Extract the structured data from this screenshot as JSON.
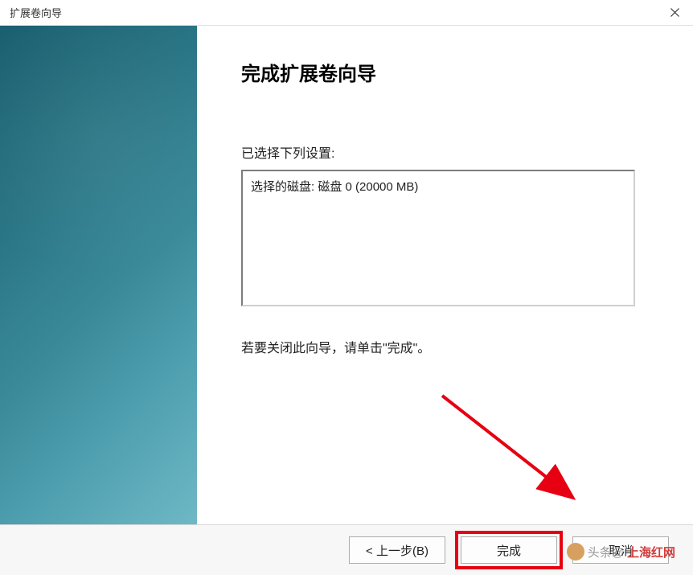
{
  "window": {
    "title": "扩展卷向导"
  },
  "wizard": {
    "heading": "完成扩展卷向导",
    "settings_label": "已选择下列设置:",
    "selected_disk": "选择的磁盘: 磁盘 0 (20000 MB)",
    "close_hint": "若要关闭此向导，请单击\"完成\"。"
  },
  "buttons": {
    "back": "< 上一步(B)",
    "finish": "完成",
    "cancel": "取消"
  },
  "watermark": {
    "left": "头条@",
    "right": "上海红网"
  }
}
